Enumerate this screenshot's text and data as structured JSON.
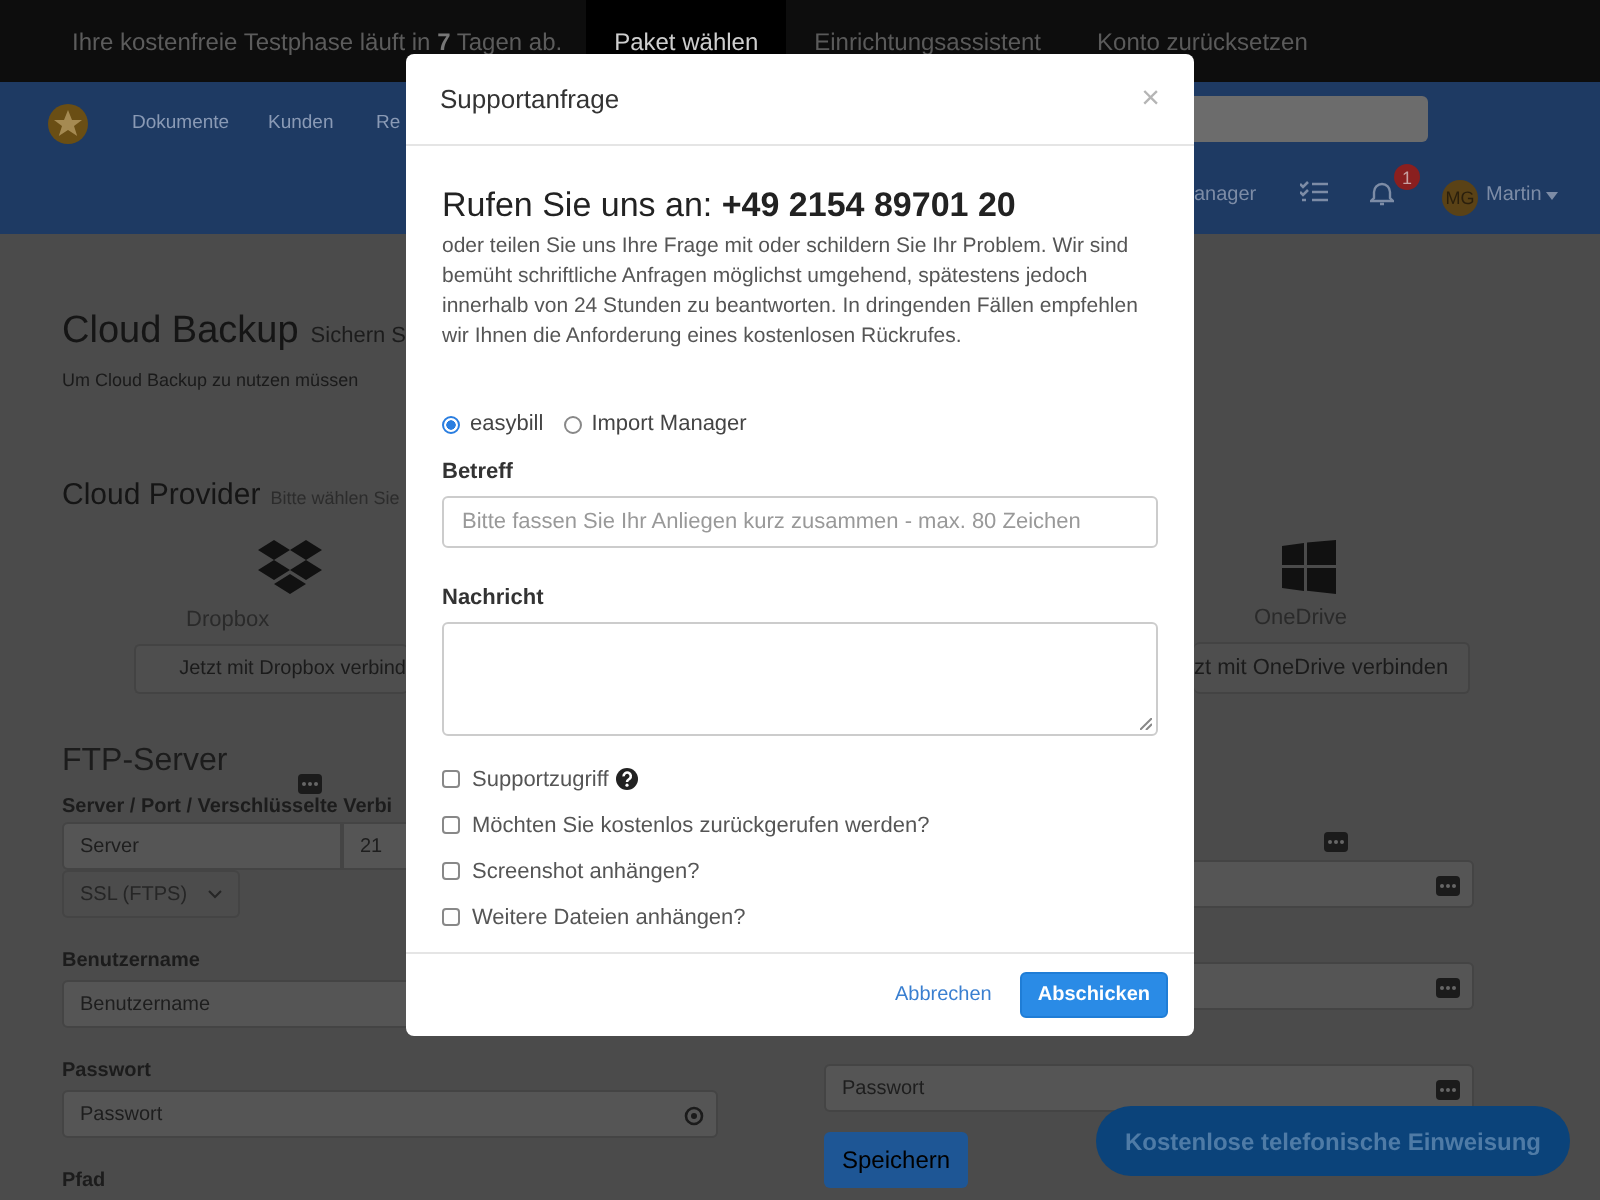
{
  "trial_bar": {
    "notice": "Ihre kostenfreie Testphase läuft in **7** Tagen ab.",
    "tabs": [
      {
        "label": "Paket wählen",
        "selected": true
      },
      {
        "label": "Einrichtungsassistent",
        "selected": false
      },
      {
        "label": "Konto zurücksetzen",
        "selected": false
      }
    ]
  },
  "navbar": {
    "items": [
      "Dokumente",
      "Kunden",
      "Re"
    ],
    "menu_fragment": "anager",
    "notifications_badge": "1",
    "avatar_initials": "MG",
    "user_name": "Martin"
  },
  "page": {
    "title": "Cloud Backup",
    "subtitle": "Sichern S",
    "intro": "Um Cloud Backup zu nutzen müssen",
    "providers_heading": "Cloud Provider",
    "providers_hint": "Bitte wählen Sie",
    "providers": [
      {
        "kind": "dropbox",
        "name": "Dropbox",
        "button": "Jetzt mit Dropbox verbind"
      },
      {
        "kind": "windows",
        "name": "OneDrive",
        "button": "zt mit OneDrive verbinden"
      }
    ],
    "ftp": {
      "heading": "FTP-Server",
      "server_label": "Server / Port / Verschlüsselte Verbi",
      "server_placeholder": "Server",
      "port": "21",
      "encryption": "SSL (FTPS)",
      "username_label": "Benutzername",
      "username_placeholder": "Benutzername",
      "password_label": "Passwort",
      "password_placeholder": "Passwort",
      "path_label": "Pfad",
      "right_password_placeholder": "Passwort",
      "save_button": "Speichern"
    },
    "callout_button": "Kostenlose telefonische Einweisung"
  },
  "dialog": {
    "title": "Supportanfrage",
    "close": "×",
    "heading": "Rufen Sie uns an: **+49 2154 89701 20**",
    "text": "oder teilen Sie uns Ihre Frage mit oder schildern Sie Ihr Problem. Wir sind bemüht schriftliche Anfragen möglichst umgehend, spätestens jedoch innerhalb von 24 Stunden zu beantworten. In dringenden Fällen empfehlen wir Ihnen die Anforderung eines kostenlosen Rückrufes.",
    "products": [
      {
        "label": "easybill",
        "selected": true
      },
      {
        "label": "Import Manager",
        "selected": false
      }
    ],
    "subject_label": "Betreff",
    "subject_placeholder": "Bitte fassen Sie Ihr Anliegen kurz zusammen - max. 80 Zeichen",
    "message_label": "Nachricht",
    "options": [
      {
        "label": "Supportzugriff",
        "checked": false,
        "help": true
      },
      {
        "label": "Möchten Sie kostenlos zurückgerufen werden?",
        "checked": false
      },
      {
        "label": "Screenshot anhängen?",
        "checked": false
      },
      {
        "label": "Weitere Dateien anhängen?",
        "checked": false
      }
    ],
    "cancel": "Abbrechen",
    "submit": "Abschicken"
  }
}
